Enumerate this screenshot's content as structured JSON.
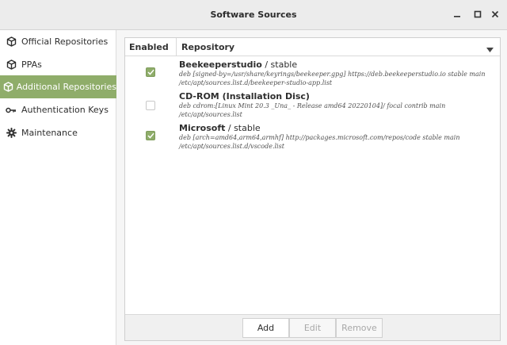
{
  "window": {
    "title": "Software Sources"
  },
  "sidebar": {
    "items": [
      {
        "label": "Official Repositories",
        "icon": "package-icon"
      },
      {
        "label": "PPAs",
        "icon": "package-icon"
      },
      {
        "label": "Additional Repositories",
        "icon": "package-icon",
        "active": true
      },
      {
        "label": "Authentication Keys",
        "icon": "key-icon"
      },
      {
        "label": "Maintenance",
        "icon": "gear-icon"
      }
    ]
  },
  "table": {
    "columns": {
      "enabled": "Enabled",
      "repository": "Repository"
    },
    "rows": [
      {
        "enabled": true,
        "name": "Beekeeperstudio",
        "suffix": " / stable",
        "line1": "deb [signed-by=/usr/share/keyrings/beekeeper.gpg] https://deb.beekeeperstudio.io stable main",
        "line2": "/etc/apt/sources.list.d/beekeeper-studio-app.list"
      },
      {
        "enabled": false,
        "name": "CD-ROM (Installation Disc)",
        "suffix": "",
        "line1": "deb cdrom:[Linux Mint 20.3 _Una_ - Release amd64 20220104]/ focal contrib main",
        "line2": "/etc/apt/sources.list"
      },
      {
        "enabled": true,
        "name": "Microsoft",
        "suffix": " / stable",
        "line1": "deb [arch=amd64,arm64,armhf] http://packages.microsoft.com/repos/code stable main",
        "line2": "/etc/apt/sources.list.d/vscode.list"
      }
    ]
  },
  "buttons": {
    "add": "Add",
    "edit": "Edit",
    "remove": "Remove"
  },
  "colors": {
    "accent": "#8fad6a"
  }
}
